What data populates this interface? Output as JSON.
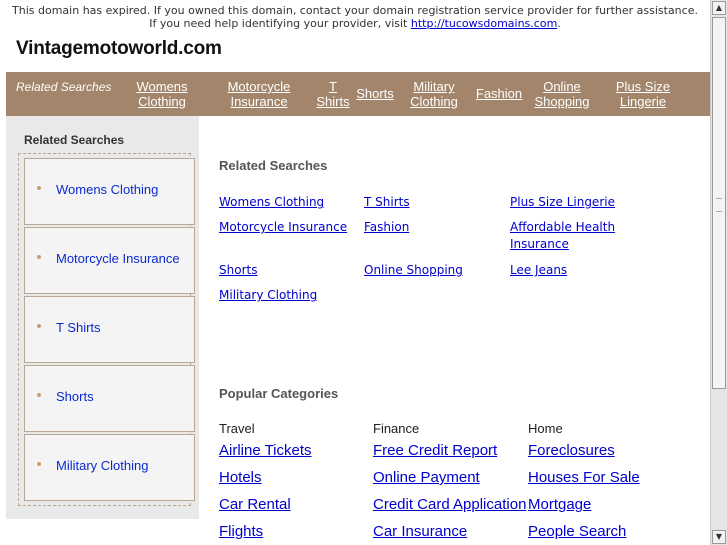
{
  "notice": {
    "text": "This domain has expired. If you owned this domain, contact your domain registration service provider for further assistance. If you need help identifying your provider, visit ",
    "link": "http://tucowsdomains.com",
    "end": "."
  },
  "site": {
    "title": "Vintagemotoworld.com"
  },
  "topbar": {
    "label": "Related Searches",
    "links": [
      {
        "line1": "Womens",
        "line2": "Clothing"
      },
      {
        "line1": "Motorcycle",
        "line2": "Insurance"
      },
      {
        "line1": "T",
        "line2": "Shirts"
      },
      {
        "line1": "Shorts",
        "line2": ""
      },
      {
        "line1": "Military",
        "line2": "Clothing"
      },
      {
        "line1": "Fashion",
        "line2": ""
      },
      {
        "line1": "Online",
        "line2": "Shopping"
      },
      {
        "line1": "Plus Size",
        "line2": "Lingerie"
      }
    ]
  },
  "sidebar": {
    "title": "Related Searches",
    "items": [
      "Womens Clothing",
      "Motorcycle Insurance",
      "T Shirts",
      "Shorts",
      "Military Clothing"
    ]
  },
  "related": {
    "title": "Related Searches",
    "links": [
      "Womens Clothing",
      "T Shirts",
      "Plus Size Lingerie",
      "Motorcycle Insurance",
      "Fashion",
      "Affordable Health Insurance",
      "Shorts",
      "Online Shopping",
      "Lee Jeans",
      "Military Clothing"
    ]
  },
  "popular": {
    "title": "Popular Categories",
    "columns": [
      {
        "heading": "Travel",
        "links": [
          "Airline Tickets",
          "Hotels",
          "Car Rental",
          "Flights"
        ]
      },
      {
        "heading": "Finance",
        "links": [
          "Free Credit Report",
          "Online Payment",
          "Credit Card Application",
          "Car Insurance"
        ]
      },
      {
        "heading": "Home",
        "links": [
          "Foreclosures",
          "Houses For Sale",
          "Mortgage",
          "People Search"
        ]
      }
    ]
  },
  "scrollbar": {
    "up_icon": "arrow-up-icon",
    "down_icon": "arrow-down-icon"
  }
}
